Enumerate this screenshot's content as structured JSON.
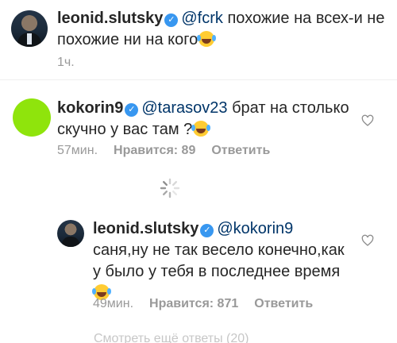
{
  "comments": [
    {
      "username": "leonid.slutsky",
      "mention": "@fcrk",
      "text_line1": "похожие на всех-и не",
      "text_line2": "похожие ни на кого",
      "time": "1ч."
    },
    {
      "username": "kokorin9",
      "mention": "@tarasov23",
      "text_line1": "брат на столько",
      "text_line2": "скучно у вас там ?",
      "time": "57мин.",
      "likes": "Нравится: 89",
      "reply": "Ответить"
    },
    {
      "username": "leonid.slutsky",
      "mention": "@kokorin9",
      "text_line1": "саня,ну не так весело конечно,как",
      "text_line2": "у было у тебя в последнее время",
      "time": "49мин.",
      "likes": "Нравится: 871",
      "reply": "Ответить"
    }
  ],
  "footer": {
    "partial": "Смотреть ещё ответы (20)"
  },
  "colors": {
    "mention": "#003569",
    "verified": "#3897f0",
    "meta": "#999999",
    "avatar_green": "#8fe40c"
  },
  "icons": {
    "verified": "verified-badge-icon",
    "heart": "heart-outline-icon",
    "spinner": "loading-spinner-icon",
    "emoji": "tears-of-joy-emoji"
  }
}
